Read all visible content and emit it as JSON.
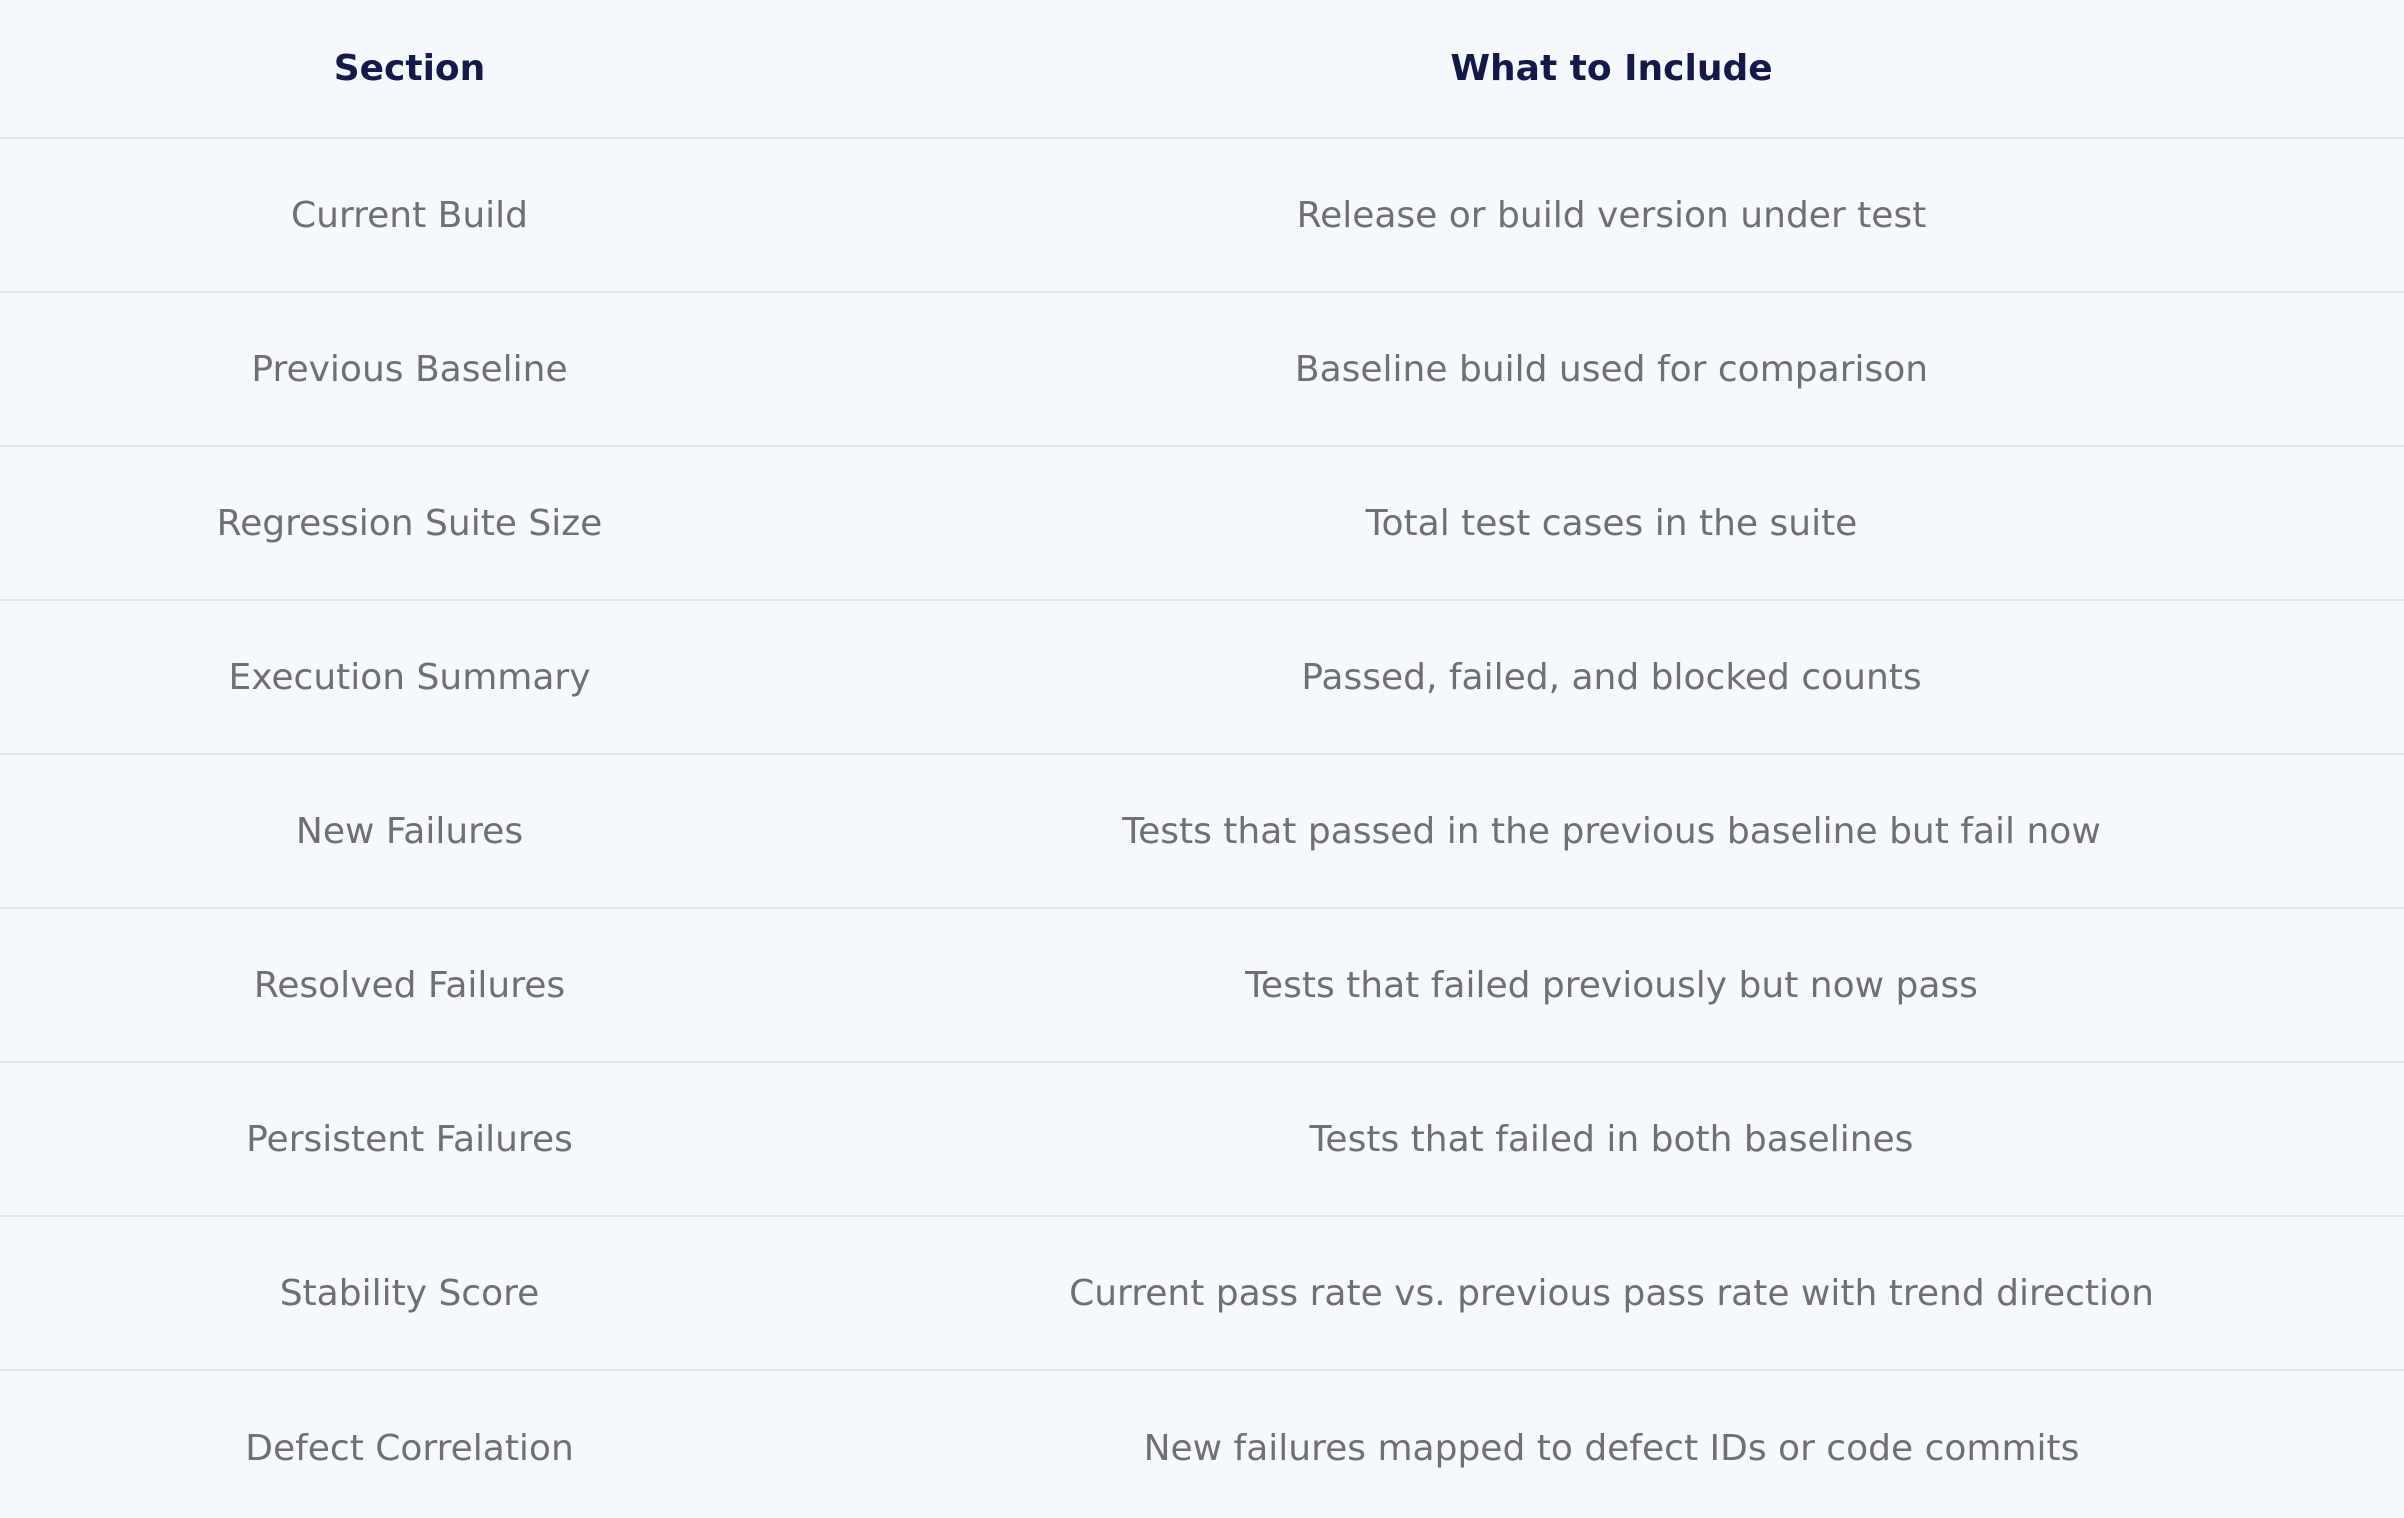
{
  "header": {
    "section": "Section",
    "include": "What to Include"
  },
  "rows": [
    {
      "section": "Current Build",
      "include": "Release or build version under test"
    },
    {
      "section": "Previous Baseline",
      "include": "Baseline build used for comparison"
    },
    {
      "section": "Regression Suite Size",
      "include": "Total test cases in the suite"
    },
    {
      "section": "Execution Summary",
      "include": "Passed, failed, and blocked counts"
    },
    {
      "section": "New Failures",
      "include": "Tests that passed in the previous baseline but fail now"
    },
    {
      "section": "Resolved Failures",
      "include": "Tests that failed previously but now pass"
    },
    {
      "section": "Persistent Failures",
      "include": "Tests that failed in both baselines"
    },
    {
      "section": "Stability Score",
      "include": "Current pass rate vs. previous pass rate with trend direction"
    },
    {
      "section": "Defect Correlation",
      "include": "New failures mapped to defect IDs or code commits"
    }
  ]
}
